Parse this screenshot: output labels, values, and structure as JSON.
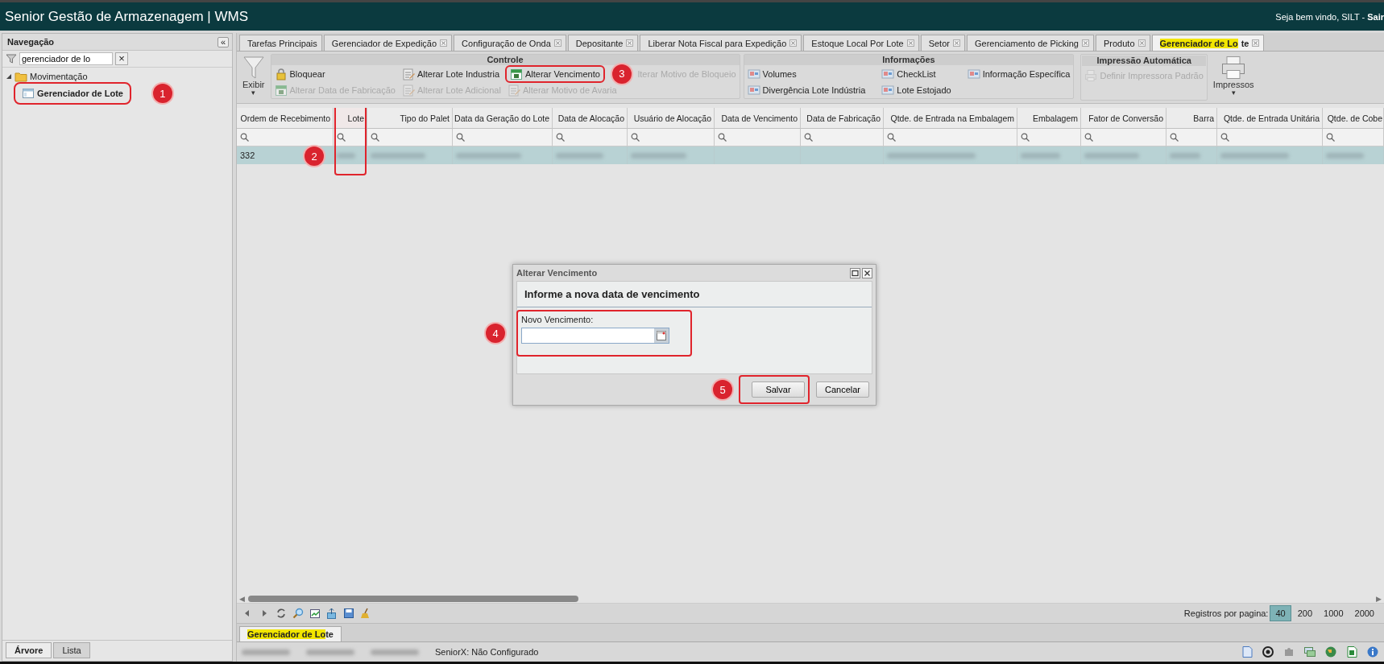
{
  "app": {
    "title": "Senior Gestão de Armazenagem | WMS",
    "welcome": "Seja bem vindo, SILT -",
    "logout": "Sair"
  },
  "navigation": {
    "title": "Navegação",
    "collapse": "«",
    "filter": "gerenciador de lo",
    "clear": "×",
    "tree": [
      {
        "label": "Movimentação",
        "expanded": true,
        "children": [
          {
            "label": "Gerenciador de Lote",
            "highlighted": true,
            "badge": "1"
          }
        ]
      }
    ],
    "tabs": [
      {
        "label": "Árvore",
        "selected": true
      },
      {
        "label": "Lista",
        "selected": false
      }
    ]
  },
  "tabs": [
    {
      "parts": [
        {
          "text": "Tarefas Principais",
          "match": false
        }
      ],
      "closable": false,
      "selected": false
    },
    {
      "parts": [
        {
          "text": "Gerenciador de Expedição",
          "match": false
        }
      ],
      "closable": true,
      "selected": false
    },
    {
      "parts": [
        {
          "text": "Configuração de Onda",
          "match": false
        }
      ],
      "closable": true,
      "selected": false
    },
    {
      "parts": [
        {
          "text": "Depositante",
          "match": false
        }
      ],
      "closable": true,
      "selected": false
    },
    {
      "parts": [
        {
          "text": "Liberar Nota Fiscal para Expedição",
          "match": false
        }
      ],
      "closable": true,
      "selected": false
    },
    {
      "parts": [
        {
          "text": "Estoque Local Por Lote",
          "match": false
        }
      ],
      "closable": true,
      "selected": false
    },
    {
      "parts": [
        {
          "text": "Setor",
          "match": false
        }
      ],
      "closable": true,
      "selected": false
    },
    {
      "parts": [
        {
          "text": "Gerenciamento de Picking",
          "match": false
        }
      ],
      "closable": true,
      "selected": false
    },
    {
      "parts": [
        {
          "text": "Produto",
          "match": false
        }
      ],
      "closable": true,
      "selected": false
    },
    {
      "parts": [
        {
          "text": "Gerenciador de Lo",
          "match": true
        },
        {
          "text": "te",
          "match": false
        }
      ],
      "closable": true,
      "selected": true
    }
  ],
  "toolbar": {
    "exibir": "Exibir",
    "exibir_caret": "▾",
    "groups": [
      {
        "title": "Controle",
        "actions": [
          {
            "label": "Bloquear",
            "kind": "lock",
            "disabled": false,
            "highlighted": false
          },
          {
            "label": "Alterar Data de Fabricação",
            "kind": "calendar",
            "disabled": true,
            "highlighted": false
          },
          {
            "label": "Alterar Lote Industria",
            "kind": "edit",
            "disabled": false,
            "highlighted": false
          },
          {
            "label": "Alterar Lote Adicional",
            "kind": "edit",
            "disabled": true,
            "highlighted": false
          },
          {
            "label": "Alterar Vencimento",
            "kind": "calendar",
            "disabled": false,
            "highlighted": true,
            "badge": "3"
          },
          {
            "label": "Alterar Motivo de Avaria",
            "kind": "edit",
            "disabled": true,
            "highlighted": false
          },
          {
            "label": "lterar Motivo de Bloqueio",
            "kind": "plain",
            "disabled": true,
            "highlighted": false
          }
        ]
      },
      {
        "title": "Informações",
        "actions": [
          {
            "label": "Volumes",
            "kind": "info",
            "disabled": false,
            "highlighted": false
          },
          {
            "label": "Divergência Lote Indústria",
            "kind": "info",
            "disabled": false,
            "highlighted": false
          },
          {
            "label": "CheckList",
            "kind": "info",
            "disabled": false,
            "highlighted": false
          },
          {
            "label": "Lote Estojado",
            "kind": "info",
            "disabled": false,
            "highlighted": false
          },
          {
            "label": "Informação Específica",
            "kind": "info",
            "disabled": false,
            "highlighted": false
          }
        ]
      },
      {
        "title": "Impressão Automática",
        "actions": [
          {
            "label": "Definir Impressora Padrão",
            "kind": "printer",
            "disabled": true,
            "highlighted": false
          }
        ]
      }
    ],
    "impressos": "Impressos",
    "caret": "▾"
  },
  "grid": {
    "columns": [
      {
        "label": "Ordem de Recebimento",
        "highlighted": false
      },
      {
        "label": "Lote",
        "highlighted": true,
        "badge": "2"
      },
      {
        "label": "Tipo do Palet",
        "highlighted": false
      },
      {
        "label": "Data da Geração do Lote",
        "highlighted": false
      },
      {
        "label": "Data de Alocação",
        "highlighted": false
      },
      {
        "label": "Usuário de Alocação",
        "highlighted": false
      },
      {
        "label": "Data de Vencimento",
        "highlighted": false
      },
      {
        "label": "Data de Fabricação",
        "highlighted": false
      },
      {
        "label": "Qtde. de Entrada na Embalagem",
        "highlighted": false
      },
      {
        "label": "Embalagem",
        "highlighted": false
      },
      {
        "label": "Fator de Conversão",
        "highlighted": false
      },
      {
        "label": "Barra",
        "highlighted": false
      },
      {
        "label": "Qtde. de Entrada Unitária",
        "highlighted": false
      },
      {
        "label": "Qtde. de Cobe",
        "highlighted": false
      }
    ],
    "scroll_left": "◀",
    "scroll_right": "▶",
    "rows": [
      {
        "selected": true,
        "cells": [
          {
            "text": "332",
            "redacted": false
          },
          {
            "redacted": true
          },
          {
            "redacted": true
          },
          {
            "redacted": true
          },
          {
            "redacted": true
          },
          {
            "redacted": true
          },
          {
            "redacted": false
          },
          {
            "redacted": false
          },
          {
            "redacted": true
          },
          {
            "redacted": true
          },
          {
            "redacted": true
          },
          {
            "redacted": true
          },
          {
            "redacted": true
          },
          {
            "redacted": true
          }
        ]
      }
    ]
  },
  "paging": {
    "label": "Registros por pagina:",
    "options": [
      {
        "label": "40",
        "selected": true
      },
      {
        "label": "200",
        "selected": false
      },
      {
        "label": "1000",
        "selected": false
      },
      {
        "label": "2000",
        "selected": false
      }
    ]
  },
  "bottom_tab": {
    "parts": [
      {
        "text": "Gerenciador de Lo",
        "match": true
      },
      {
        "text": "te",
        "match": false
      }
    ],
    "selected": true
  },
  "status_bar": {
    "redacted_items": [
      {
        "redacted": true
      },
      {
        "redacted": true
      },
      {
        "redacted": true
      }
    ],
    "text": "SeniorX: Não Configurado"
  },
  "dialog": {
    "title": "Alterar Vencimento",
    "heading": "Informe a nova data de vencimento",
    "field": {
      "label": "Novo Vencimento:",
      "highlighted": true,
      "badge": "4"
    },
    "buttons": [
      {
        "label": "Salvar",
        "highlighted": true,
        "badge": "5"
      },
      {
        "label": "Cancelar",
        "highlighted": false
      }
    ]
  }
}
